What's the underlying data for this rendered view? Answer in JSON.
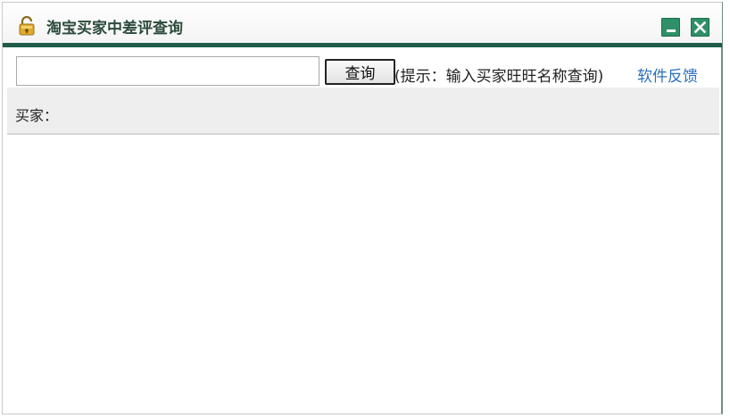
{
  "window": {
    "title": "淘宝买家中差评查询",
    "lock_icon": "lock-icon",
    "minimize_icon": "minimize-icon",
    "close_icon": "close-icon",
    "accent_color": "#1f5c4a",
    "button_color": "#2f8f67"
  },
  "search": {
    "input_value": "",
    "input_placeholder": "",
    "button_label": "查询",
    "hint": "(提示：输入买家旺旺名称查询)",
    "feedback_link": "软件反馈",
    "link_color": "#2a6fbf"
  },
  "result": {
    "buyer_label": "买家："
  }
}
